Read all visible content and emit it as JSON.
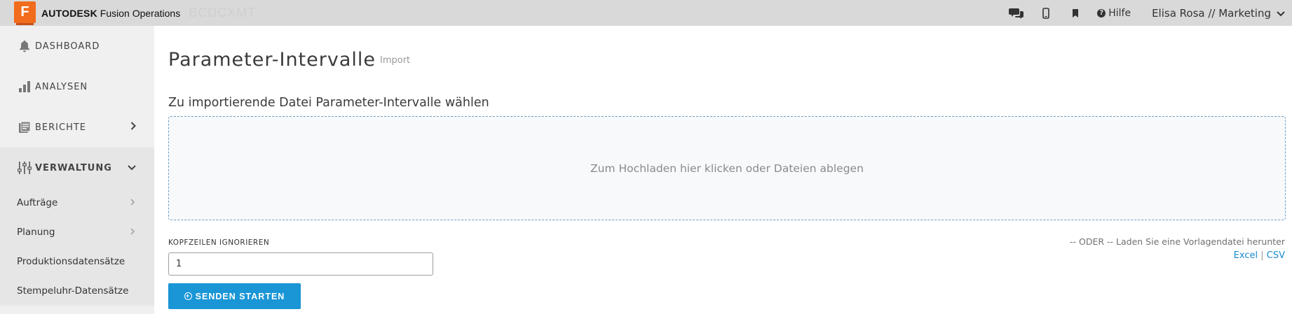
{
  "topbar": {
    "brand_bold": "AUTODESK",
    "brand_rest": "Fusion Operations",
    "logo_letter": "F",
    "ghost_text": "BCDCXMT",
    "help_label": "Hilfe",
    "user_label": "Elisa Rosa // Marketing",
    "icons": [
      "chat-icon",
      "mobile-icon",
      "bookmark-icon",
      "help-icon",
      "chevron-down-icon"
    ]
  },
  "sidebar": {
    "items": [
      {
        "label": "DASHBOARD",
        "icon": "bell-icon"
      },
      {
        "label": "ANALYSEN",
        "icon": "bar-chart-icon"
      },
      {
        "label": "BERICHTE",
        "icon": "report-icon"
      },
      {
        "label": "VERWALTUNG",
        "icon": "sliders-icon"
      }
    ],
    "sub_items": [
      {
        "label": "Aufträge"
      },
      {
        "label": "Planung"
      },
      {
        "label": "Produktionsdatensätze"
      },
      {
        "label": "Stempeluhr-Datensätze"
      }
    ]
  },
  "main": {
    "title": "Parameter-Intervalle",
    "subtitle": "Import",
    "section_title": "Zu importierende Datei Parameter-Intervalle wählen",
    "dropzone_text": "Zum Hochladen hier klicken oder Dateien ablegen",
    "skip_label": "KOPFZEILEN IGNORIEREN",
    "skip_value": "1",
    "submit_label": "SENDEN STARTEN",
    "template_text": "-- ODER -- Laden Sie eine Vorlagendatei herunter",
    "excel_label": "Excel",
    "separator": "|",
    "csv_label": "CSV"
  },
  "colors": {
    "accent": "#1a96d6",
    "logo": "#f26c1d",
    "topbar": "#d9d9d9",
    "sidebar": "#f0f0f0"
  }
}
